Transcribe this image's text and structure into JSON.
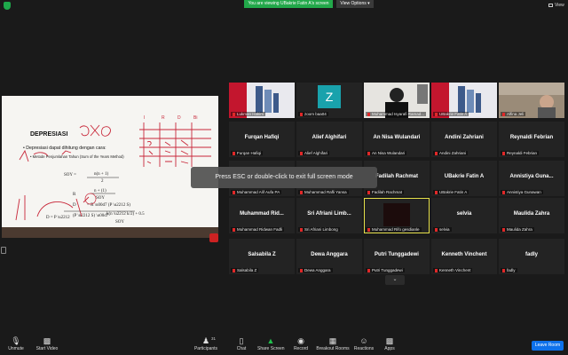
{
  "topbar": {
    "banner_text": "You are viewing UBakrie Fatin A's screen",
    "view_options_label": "View Options ▾",
    "view_label": "View"
  },
  "shared_screen": {
    "slide_title": "DEPRESIASI",
    "bullet_1": "• Depresiasi dapat dihitung dengan cara:",
    "bullet_2": "• Metode Penjumlahan Tahun (Sum of the Years Method)"
  },
  "toast": {
    "text": "Press ESC or double-click to exit full screen mode"
  },
  "participants": [
    {
      "display": "",
      "label": "Lukman Hakim",
      "type": "video-banner"
    },
    {
      "display": "Z",
      "label": "zoom baa04",
      "type": "avatar"
    },
    {
      "display": "",
      "label": "Muhammad Isyarafi Ramad...",
      "type": "video-person"
    },
    {
      "display": "",
      "label": "UBakrie Fatin A",
      "type": "video-banner"
    },
    {
      "display": "",
      "label": "Alfina Jeli",
      "type": "video-room"
    },
    {
      "display": "Furqan Hafiqi",
      "label": "Furqan Hafiqi",
      "type": "name"
    },
    {
      "display": "Alief Alghifari",
      "label": "Alief Alghifari",
      "type": "name"
    },
    {
      "display": "An Nisa Wulandari",
      "label": "An Nisa Wulandari",
      "type": "name"
    },
    {
      "display": "Andini Zahriani",
      "label": "Andini Zahriani",
      "type": "name"
    },
    {
      "display": "Reynaldi Febrian",
      "label": "Reynaldi Febrian",
      "type": "name"
    },
    {
      "display": "Muhammad Alif Aufa P...",
      "label": "Muhammad Alif Aufa PA",
      "type": "name-hidden"
    },
    {
      "display": "",
      "label": "Muhammad Rafli Yansa",
      "type": "name-hidden"
    },
    {
      "display": "Fadilah Rachmat",
      "label": "Fadilah Rachmat",
      "type": "name"
    },
    {
      "display": "UBakrie Fatin A",
      "label": "UBakrie Fatin A",
      "type": "name"
    },
    {
      "display": "Annistiya Guna...",
      "label": "Annistiya Gunawan",
      "type": "name"
    },
    {
      "display": "Muhammad Rid...",
      "label": "Muhammad Ridwan Fadli",
      "type": "name"
    },
    {
      "display": "Sri Afriani Limb...",
      "label": "Sri Afriani Limbong",
      "type": "name"
    },
    {
      "display": "",
      "label": "Muhammad Rifo gesdianle",
      "type": "video-dark"
    },
    {
      "display": "selvia",
      "label": "selvia",
      "type": "name"
    },
    {
      "display": "Maulida Zahra",
      "label": "Maulida Zahra",
      "type": "name"
    },
    {
      "display": "Salsabila Z",
      "label": "Salsabila Z",
      "type": "name"
    },
    {
      "display": "Dewa Anggara",
      "label": "Dewa Anggara",
      "type": "name"
    },
    {
      "display": "Putri Tunggadewi",
      "label": "Putri Tunggadewi",
      "type": "name"
    },
    {
      "display": "Kenneth Vinchent",
      "label": "Kenneth Vinchent",
      "type": "name"
    },
    {
      "display": "fadly",
      "label": "fadly",
      "type": "name"
    }
  ],
  "toolbar": {
    "unmute": "Unmute",
    "start_video": "Start Video",
    "participants": "Participants",
    "participants_count": "31",
    "chat": "Chat",
    "share_screen": "Share Screen",
    "record": "Record",
    "breakout_rooms": "Breakout Rooms",
    "reactions": "Reactions",
    "apps": "Apps",
    "leave_room": "Leave Room"
  },
  "colors": {
    "accent_green": "#22a84a",
    "leave_blue": "#0e71eb",
    "muted_red": "#e02828",
    "active_speaker": "#e6e04a"
  }
}
